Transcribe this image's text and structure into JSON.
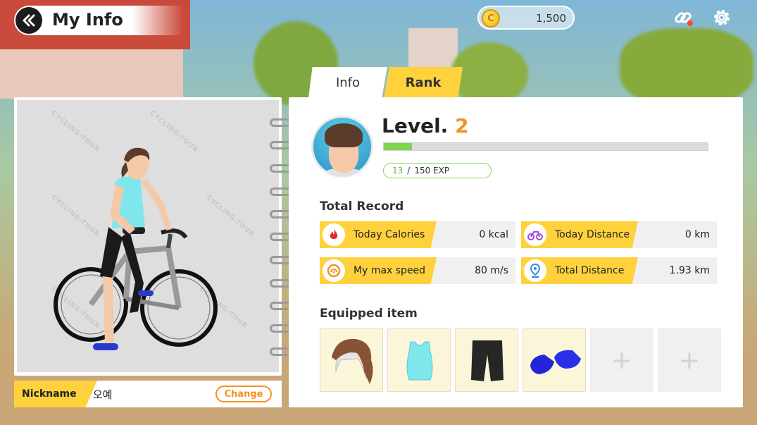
{
  "header": {
    "title": "My Info",
    "back_icon": "double-chevron-left-icon"
  },
  "currency": {
    "coins": "1,500",
    "coin_symbol": "C"
  },
  "toolbar": {
    "link_icon": "link-icon",
    "settings_icon": "gear-icon"
  },
  "tabs": [
    {
      "label": "Info",
      "active": true
    },
    {
      "label": "Rank",
      "active": false
    }
  ],
  "character": {
    "watermark": "CYCLING-TOUR",
    "nickname_label": "Nickname",
    "nickname": "오예",
    "change_label": "Change"
  },
  "profile": {
    "level_label": "Level.",
    "level": "2",
    "exp_current": "13",
    "exp_separator": "/",
    "exp_total": "150 EXP",
    "exp_progress_fraction": 0.087
  },
  "total_record": {
    "title": "Total Record",
    "stats": [
      {
        "label": "Today Calories",
        "value": "0 kcal",
        "icon": "fire-icon"
      },
      {
        "label": "Today Distance",
        "value": "0 km",
        "icon": "bicycle-icon"
      },
      {
        "label": "My max speed",
        "value": "80 m/s",
        "icon": "speedometer-icon"
      },
      {
        "label": "Total Distance",
        "value": "1.93 km",
        "icon": "location-pin-icon"
      }
    ]
  },
  "equipped": {
    "title": "Equipped item",
    "items": [
      {
        "name": "hair-item-icon"
      },
      {
        "name": "top-item-icon"
      },
      {
        "name": "shorts-item-icon"
      },
      {
        "name": "shoes-item-icon"
      },
      {
        "name": "empty-slot",
        "symbol": "+"
      },
      {
        "name": "empty-slot",
        "symbol": "+"
      }
    ]
  },
  "colors": {
    "accent_yellow": "#ffd23d",
    "accent_orange": "#f3921e",
    "exp_green": "#7fd44e"
  }
}
